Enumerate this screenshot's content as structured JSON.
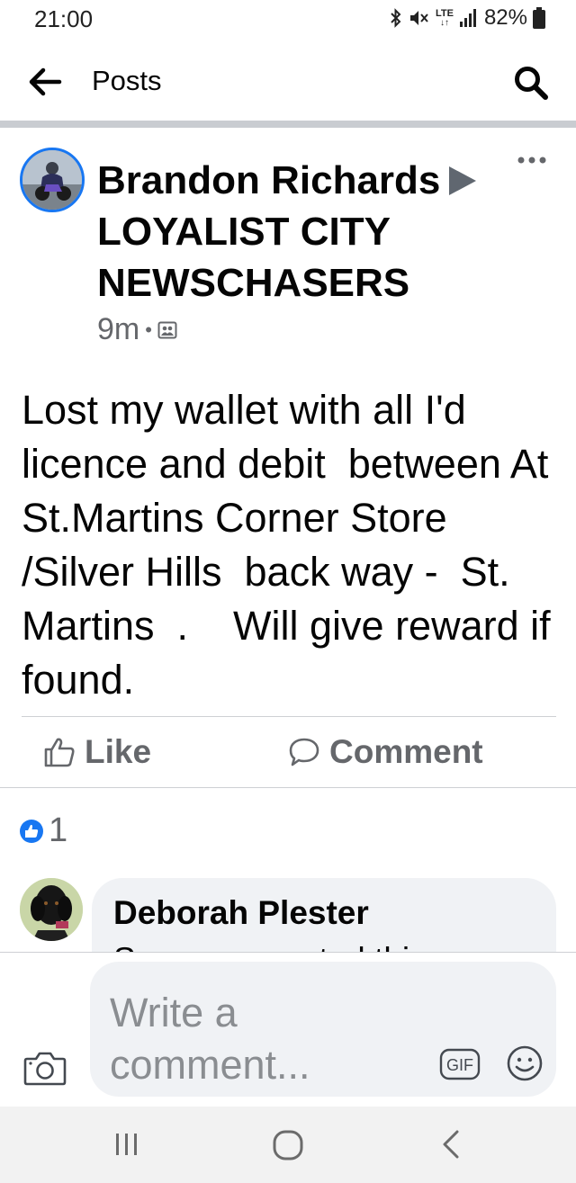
{
  "status_bar": {
    "time": "21:00",
    "lte_label": "LTE",
    "battery": "82%"
  },
  "header": {
    "title": "Posts",
    "icons": [
      "back-arrow-icon",
      "search-icon"
    ]
  },
  "post": {
    "author": "Brandon Richards",
    "group": "LOYALIST CITY NEWSCHASERS",
    "time": "9m",
    "meta_separator": "•",
    "body": "Lost my wallet with all I'd licence and debit  between At St.Martins Corner Store /Silver Hills  back way -  St. Martins  .    Will give reward if found.",
    "actions": {
      "like": "Like",
      "comment": "Comment"
    },
    "reaction_count": "1"
  },
  "comment": {
    "author": "Deborah Plester",
    "text": "Someone posted this"
  },
  "composer": {
    "placeholder": "Write a comment...",
    "gif_label": "GIF"
  },
  "colors": {
    "accent": "#1877f2",
    "secondary_text": "#65676b",
    "bubble": "#f0f2f5",
    "divider": "#c9ccd1"
  }
}
